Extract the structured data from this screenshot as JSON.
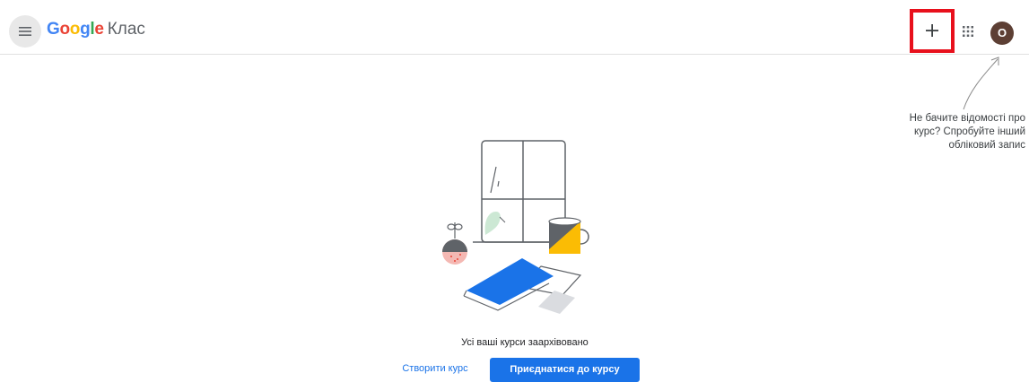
{
  "header": {
    "brand_google": [
      "G",
      "o",
      "o",
      "g",
      "l",
      "e"
    ],
    "brand_colors": [
      "#4285f4",
      "#ea4335",
      "#fbbc05",
      "#4285f4",
      "#34a853",
      "#ea4335"
    ],
    "product_name": "Клас",
    "menu_icon": "hamburger-menu-icon",
    "add_icon": "plus-icon",
    "add_highlight_color": "#e8101c",
    "apps_icon": "apps-grid-icon",
    "avatar_letter": "О",
    "avatar_color": "#5d3f34"
  },
  "hint": {
    "text": "Не бачите відомості про курс? Спробуйте інший обліковий запис"
  },
  "empty_state": {
    "title": "Усі ваші курси заархівовано",
    "create_label": "Створити курс",
    "join_label": "Приєднатися до курсу",
    "accent": "#1a73e8"
  }
}
